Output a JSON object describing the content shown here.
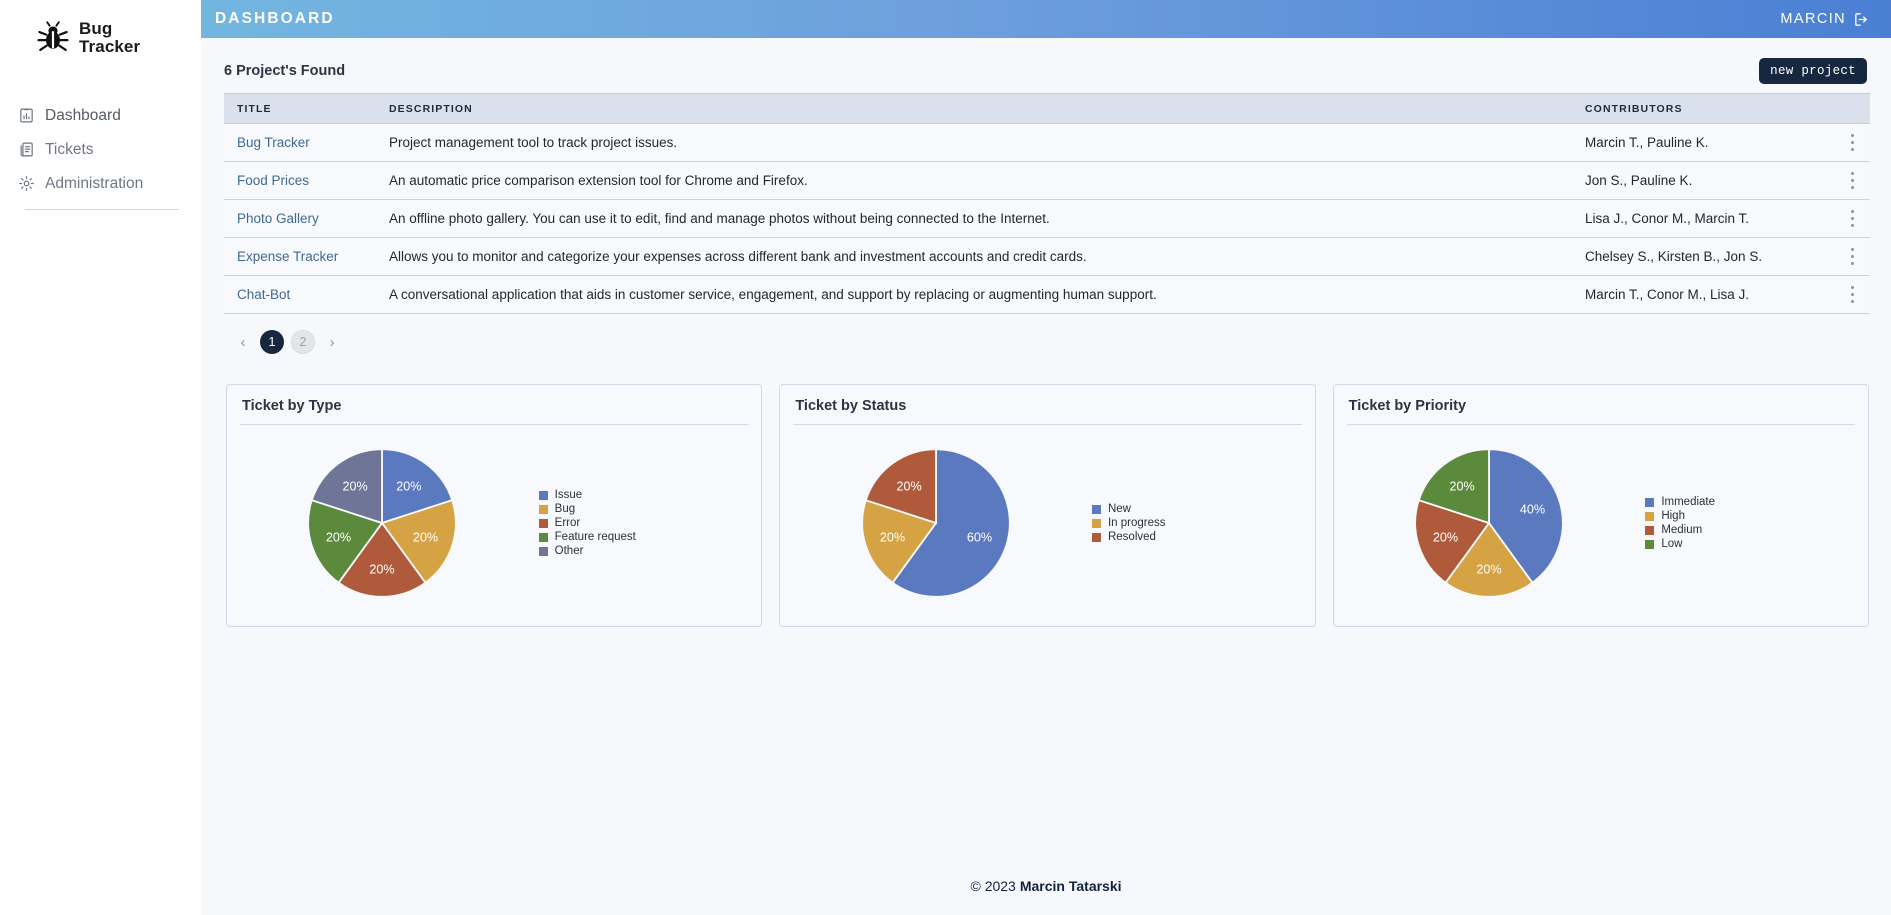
{
  "brand": {
    "line1": "Bug",
    "line2": "Tracker",
    "logo_icon": "bug-icon"
  },
  "sidebar": {
    "items": [
      {
        "label": "Dashboard",
        "icon": "chart-clipboard-icon",
        "active": true
      },
      {
        "label": "Tickets",
        "icon": "document-icon",
        "active": false
      },
      {
        "label": "Administration",
        "icon": "gear-icon",
        "active": false
      }
    ]
  },
  "topbar": {
    "title": "DASHBOARD",
    "user": "MARCIN",
    "logout_icon": "logout-icon"
  },
  "projects_panel": {
    "heading": "6 Project's Found",
    "new_project_label": "new project",
    "columns": [
      "TITLE",
      "DESCRIPTION",
      "CONTRIBUTORS"
    ],
    "rows": [
      {
        "title": "Bug Tracker",
        "description": "Project management tool to track project issues.",
        "contributors": "Marcin T., Pauline K."
      },
      {
        "title": "Food Prices",
        "description": "An automatic price comparison extension tool for Chrome and Firefox.",
        "contributors": "Jon S., Pauline K."
      },
      {
        "title": "Photo Gallery",
        "description": "An offline photo gallery. You can use it to edit, find and manage photos without being connected to the Internet.",
        "contributors": "Lisa J., Conor M., Marcin T."
      },
      {
        "title": "Expense Tracker",
        "description": "Allows you to monitor and categorize your expenses across different bank and investment accounts and credit cards.",
        "contributors": "Chelsey S., Kirsten B., Jon S."
      },
      {
        "title": "Chat-Bot",
        "description": "A conversational application that aids in customer service, engagement, and support by replacing or augmenting human support.",
        "contributors": "Marcin T., Conor M., Lisa J."
      }
    ]
  },
  "pagination": {
    "prev_label": "‹",
    "next_label": "›",
    "pages": [
      "1",
      "2"
    ],
    "current": "1"
  },
  "chart_data": [
    {
      "type": "pie",
      "title": "Ticket by Type",
      "categories": [
        "Issue",
        "Bug",
        "Error",
        "Feature request",
        "Other"
      ],
      "values": [
        20,
        20,
        20,
        20,
        20
      ],
      "labels": [
        "20%",
        "20%",
        "20%",
        "20%",
        "20%"
      ],
      "colors": [
        "#5b79be",
        "#d5a343",
        "#b05a3c",
        "#5c8a3c",
        "#6e7596"
      ],
      "legend_position": "right",
      "start_angle": 0,
      "direction": "clockwise",
      "unit": "%"
    },
    {
      "type": "pie",
      "title": "Ticket by Status",
      "categories": [
        "New",
        "In progress",
        "Resolved"
      ],
      "values": [
        60,
        20,
        20
      ],
      "labels": [
        "60%",
        "20%",
        "20%"
      ],
      "colors": [
        "#5b79be",
        "#d5a343",
        "#b05a3c"
      ],
      "legend_position": "right",
      "start_angle": 0,
      "direction": "clockwise",
      "unit": "%"
    },
    {
      "type": "pie",
      "title": "Ticket by Priority",
      "categories": [
        "Immediate",
        "High",
        "Medium",
        "Low"
      ],
      "values": [
        40,
        20,
        20,
        20
      ],
      "labels": [
        "40%",
        "20%",
        "20%",
        "20%"
      ],
      "colors": [
        "#5b79be",
        "#d5a343",
        "#b05a3c",
        "#5c8a3c"
      ],
      "legend_position": "right",
      "start_angle": 0,
      "direction": "clockwise",
      "unit": "%"
    }
  ],
  "footer": {
    "copyright": "© 2023",
    "author": "Marcin Tatarski"
  }
}
